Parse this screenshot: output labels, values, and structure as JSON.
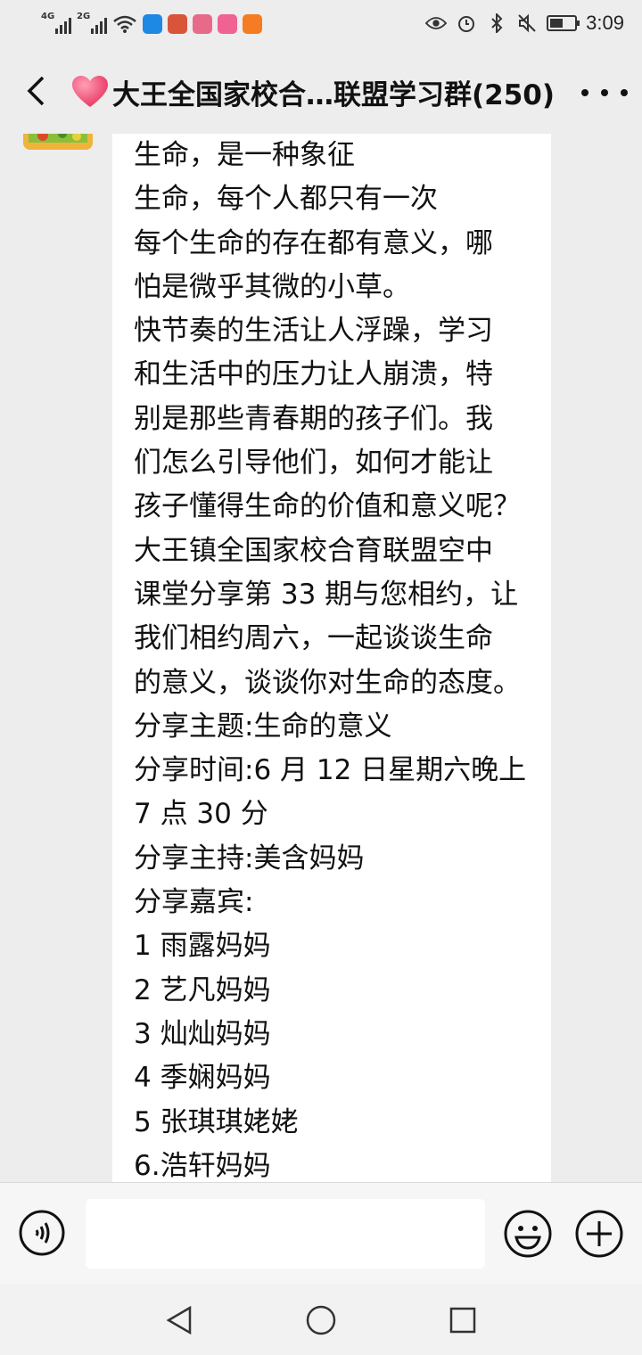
{
  "status_bar": {
    "network1": "4G",
    "network2": "2G",
    "time": "3:09",
    "battery_level": 0.55,
    "icons": [
      "signal-icon",
      "wifi-icon",
      "zhihu-app-icon",
      "app-notification-icon",
      "eye-icon",
      "alarm-icon",
      "bluetooth-icon",
      "mute-icon",
      "battery-icon"
    ]
  },
  "header": {
    "title": "大王全国家校合…联盟学习群(250)"
  },
  "message": {
    "lines": [
      "生命，是一种象征",
      "生命，每个人都只有一次",
      "每个生命的存在都有意义，哪",
      "怕是微乎其微的小草。",
      "快节奏的生活让人浮躁，学习",
      "和生活中的压力让人崩溃，特",
      "别是那些青春期的孩子们。我",
      "们怎么引导他们，如何才能让",
      "孩子懂得生命的价值和意义呢？",
      "大王镇全国家校合育联盟空中",
      "课堂分享第 33 期与您相约，让",
      "我们相约周六，一起谈谈生命",
      "的意义，谈谈你对生命的态度。",
      "分享主题:生命的意义",
      "分享时间:6 月 12 日星期六晚上",
      "7 点 30 分",
      "分享主持:美含妈妈",
      "分享嘉宾:",
      "1 雨露妈妈",
      "2 艺凡妈妈",
      "3 灿灿妈妈",
      "4 季娴妈妈",
      "5 张琪琪姥姥",
      "6.浩轩妈妈"
    ]
  },
  "input": {
    "placeholder": ""
  },
  "colors": {
    "background": "#ededed",
    "bubble": "#ffffff",
    "heart": "#f0557a"
  }
}
